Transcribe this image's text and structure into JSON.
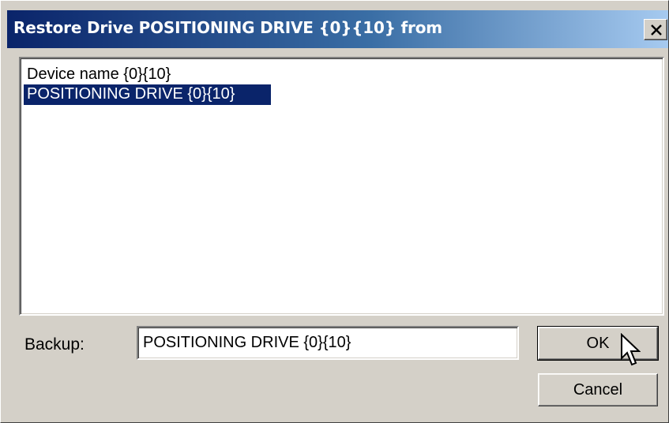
{
  "dialog": {
    "title": "Restore Drive POSITIONING DRIVE {0}{10} from",
    "close_icon": "close-icon"
  },
  "list": {
    "items": [
      {
        "label": "Device name {0}{10}",
        "selected": false
      },
      {
        "label": "POSITIONING DRIVE {0}{10}",
        "selected": true
      }
    ]
  },
  "backup": {
    "label": "Backup:",
    "value": "POSITIONING DRIVE {0}{10}"
  },
  "buttons": {
    "ok_label": "OK",
    "cancel_label": "Cancel"
  },
  "colors": {
    "title_bar_start": "#0a246a",
    "title_bar_end": "#a6caf0",
    "selection": "#0a246a",
    "face": "#d4d0c8"
  },
  "pointer_icon": "arrow-cursor-icon"
}
